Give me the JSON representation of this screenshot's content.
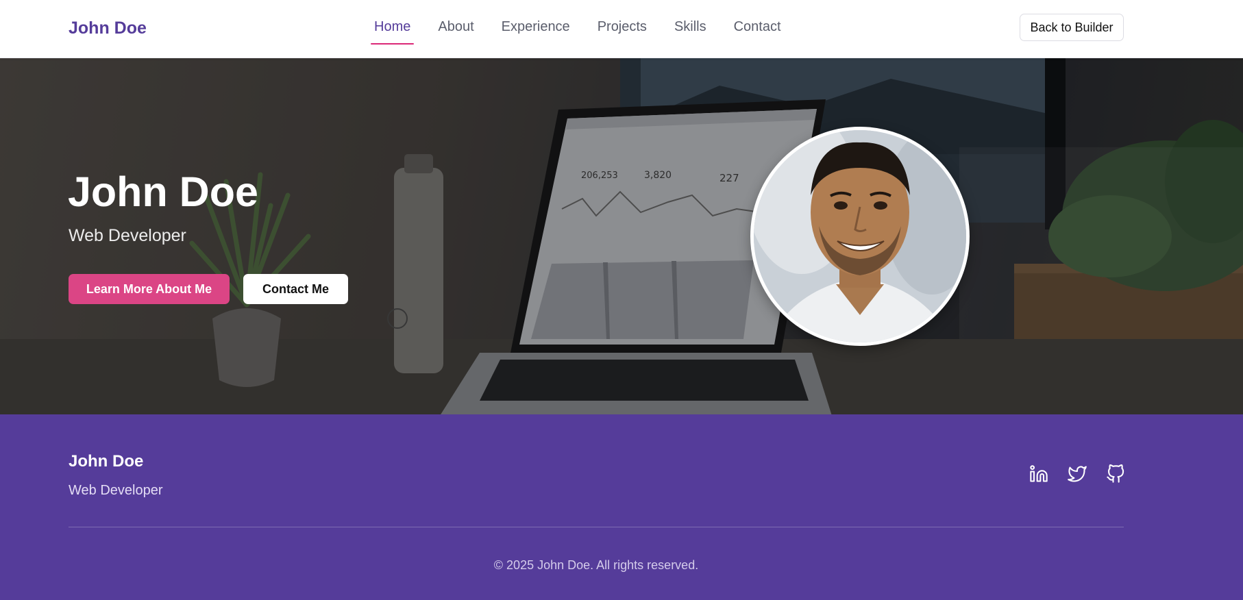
{
  "nav": {
    "brand": "John Doe",
    "links": [
      {
        "label": "Home",
        "active": true
      },
      {
        "label": "About"
      },
      {
        "label": "Experience"
      },
      {
        "label": "Projects"
      },
      {
        "label": "Skills"
      },
      {
        "label": "Contact"
      }
    ],
    "back_button": "Back to Builder"
  },
  "hero": {
    "name": "John Doe",
    "role": "Web Developer",
    "primary_button": "Learn More About Me",
    "secondary_button": "Contact Me",
    "background_icon": "laptop-desk-photo",
    "avatar_icon": "profile-photo"
  },
  "footer": {
    "name": "John Doe",
    "role": "Web Developer",
    "social_icons": [
      "linkedin-icon",
      "twitter-icon",
      "github-icon"
    ],
    "copyright": "© 2025 John Doe. All rights reserved."
  },
  "colors": {
    "brand": "#553c9a",
    "accent": "#db2777",
    "primary_button": "#db4585",
    "footer_bg": "#553c9a"
  }
}
